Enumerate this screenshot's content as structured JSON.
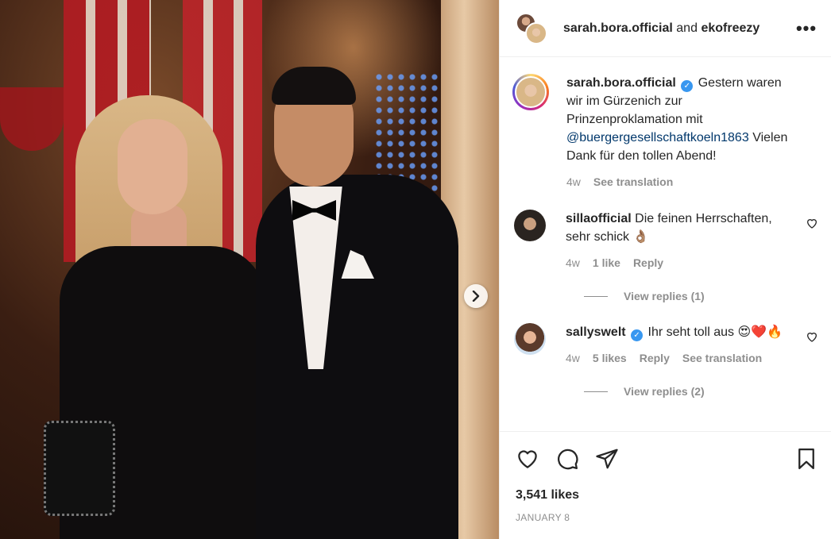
{
  "header": {
    "user1": "sarah.bora.official",
    "connector": "and",
    "user2": "ekofreezy",
    "more_label": "•••"
  },
  "caption": {
    "username": "sarah.bora.official",
    "text_before": "Gestern waren wir im Gürzenich zur Prinzenproklamation mit",
    "mention": "@buergergesellschaftkoeln1863",
    "text_after": "Vielen Dank für den tollen Abend!",
    "time": "4w",
    "translate": "See translation"
  },
  "comments": [
    {
      "username": "sillaofficial",
      "text": "Die feinen Herrschaften, sehr schick 👌🏽",
      "time": "4w",
      "likes": "1 like",
      "reply": "Reply",
      "view_replies": "View replies (1)"
    },
    {
      "username": "sallyswelt",
      "text": "Ihr seht toll aus 😍❤️🔥",
      "time": "4w",
      "likes": "5 likes",
      "reply": "Reply",
      "translate": "See translation",
      "view_replies": "View replies (2)"
    }
  ],
  "footer": {
    "likes": "3,541 likes",
    "date": "JANUARY 8"
  },
  "colors": {
    "verified": "#3897f0",
    "mention": "#00376b",
    "muted": "#8e8e8e"
  },
  "icons": [
    "heart-icon",
    "comment-icon",
    "share-icon",
    "bookmark-icon",
    "chevron-right-icon",
    "verified-badge-icon",
    "more-icon"
  ]
}
